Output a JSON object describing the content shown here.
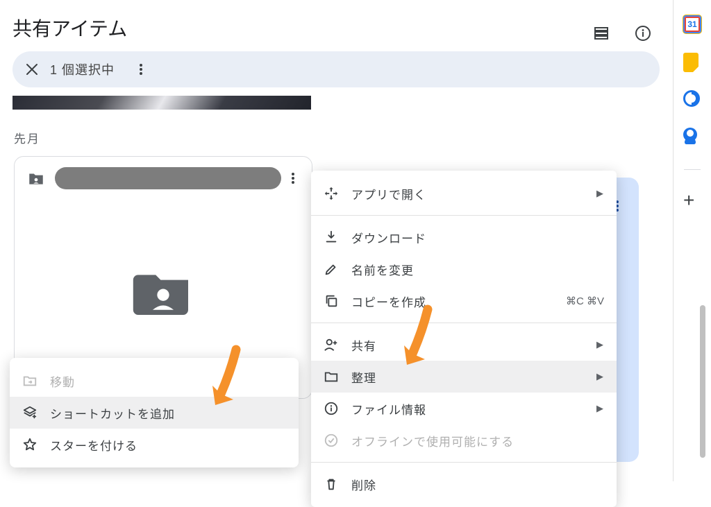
{
  "header": {
    "title": "共有アイテム",
    "layout_icon": "list-layout-icon",
    "info_icon": "info-icon"
  },
  "selection_bar": {
    "close_icon": "close",
    "text": "1 個選択中",
    "more_icon": "more-vert"
  },
  "section_label": "先月",
  "card": {
    "folder_icon": "shared-folder",
    "more_icon": "more-vert"
  },
  "main_menu": {
    "items": [
      {
        "icon": "open-with",
        "label": "アプリで開く",
        "arrow": true
      },
      {
        "sep": true
      },
      {
        "icon": "download",
        "label": "ダウンロード"
      },
      {
        "icon": "edit",
        "label": "名前を変更"
      },
      {
        "icon": "copy",
        "label": "コピーを作成",
        "shortcut": "⌘C ⌘V"
      },
      {
        "sep": true
      },
      {
        "icon": "person-add",
        "label": "共有",
        "arrow": true
      },
      {
        "icon": "folder",
        "label": "整理",
        "arrow": true,
        "hover": true
      },
      {
        "icon": "info",
        "label": "ファイル情報",
        "arrow": true
      },
      {
        "icon": "offline",
        "label": "オフラインで使用可能にする",
        "disabled": true
      },
      {
        "sep": true
      },
      {
        "icon": "delete",
        "label": "削除"
      }
    ]
  },
  "submenu": {
    "items": [
      {
        "icon": "move",
        "label": "移動",
        "disabled": true
      },
      {
        "icon": "add-shortcut",
        "label": "ショートカットを追加",
        "hover": true
      },
      {
        "icon": "star",
        "label": "スターを付ける"
      }
    ]
  },
  "sidepanel": {
    "calendar_day": "31"
  }
}
